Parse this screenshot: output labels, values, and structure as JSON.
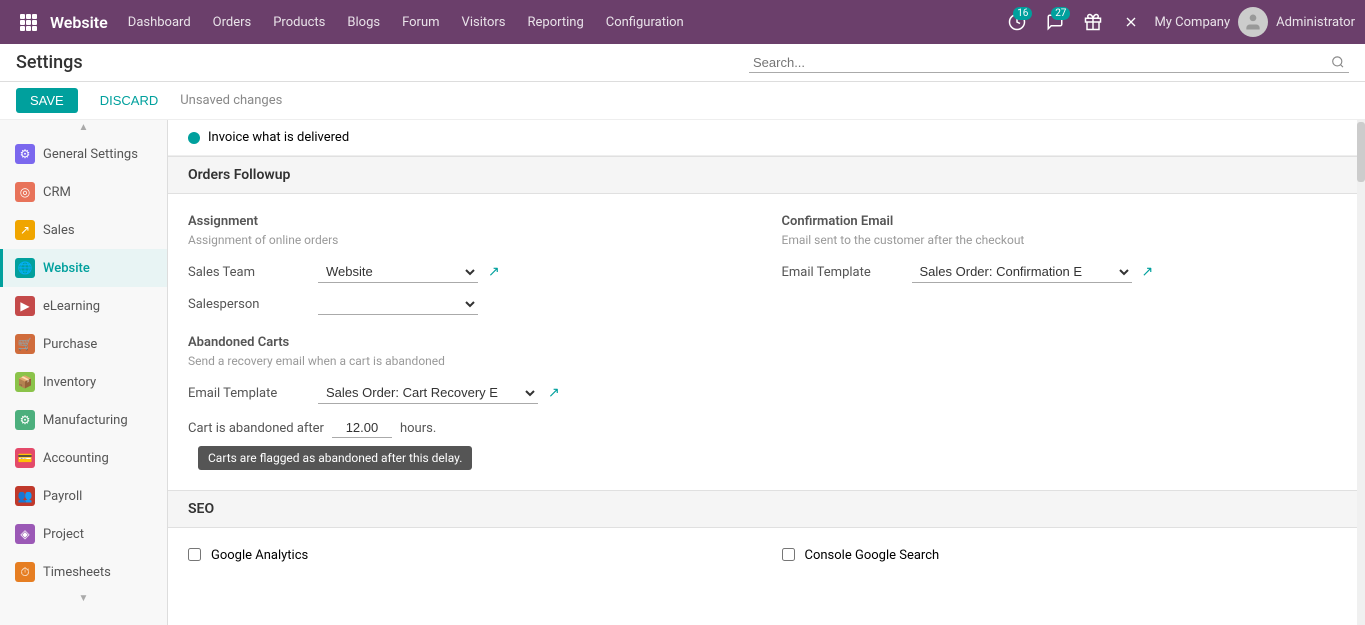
{
  "app": {
    "brand": "Website",
    "nav_links": [
      "Dashboard",
      "Orders",
      "Products",
      "Blogs",
      "Forum",
      "Visitors",
      "Reporting",
      "Configuration"
    ],
    "active_nav": "Website",
    "badge_clock": "16",
    "badge_chat": "27",
    "company": "My Company",
    "user": "Administrator"
  },
  "header": {
    "title": "Settings",
    "search_placeholder": "Search...",
    "save_label": "SAVE",
    "discard_label": "DISCARD",
    "unsaved_label": "Unsaved changes"
  },
  "sidebar": {
    "items": [
      {
        "id": "general-settings",
        "label": "General Settings",
        "icon": "⚙",
        "icon_class": "icon-general"
      },
      {
        "id": "crm",
        "label": "CRM",
        "icon": "◎",
        "icon_class": "icon-crm"
      },
      {
        "id": "sales",
        "label": "Sales",
        "icon": "📈",
        "icon_class": "icon-sales"
      },
      {
        "id": "website",
        "label": "Website",
        "icon": "🌐",
        "icon_class": "icon-website",
        "active": true
      },
      {
        "id": "elearning",
        "label": "eLearning",
        "icon": "▶",
        "icon_class": "icon-elearning"
      },
      {
        "id": "purchase",
        "label": "Purchase",
        "icon": "🛒",
        "icon_class": "icon-purchase"
      },
      {
        "id": "inventory",
        "label": "Inventory",
        "icon": "📦",
        "icon_class": "icon-inventory"
      },
      {
        "id": "manufacturing",
        "label": "Manufacturing",
        "icon": "⚙",
        "icon_class": "icon-manufacturing"
      },
      {
        "id": "accounting",
        "label": "Accounting",
        "icon": "💳",
        "icon_class": "icon-accounting"
      },
      {
        "id": "payroll",
        "label": "Payroll",
        "icon": "👥",
        "icon_class": "icon-payroll"
      },
      {
        "id": "project",
        "label": "Project",
        "icon": "◈",
        "icon_class": "icon-project"
      },
      {
        "id": "timesheets",
        "label": "Timesheets",
        "icon": "⏱",
        "icon_class": "icon-timesheets"
      }
    ]
  },
  "content": {
    "invoice_text": "Invoice what is delivered",
    "orders_followup_title": "Orders Followup",
    "assignment": {
      "title": "Assignment",
      "description": "Assignment of online orders",
      "sales_team_label": "Sales Team",
      "sales_team_value": "Website",
      "salesperson_label": "Salesperson",
      "salesperson_value": ""
    },
    "confirmation_email": {
      "title": "Confirmation Email",
      "description": "Email sent to the customer after the checkout",
      "email_template_label": "Email Template",
      "email_template_value": "Sales Order: Confirmation E"
    },
    "abandoned_carts": {
      "title": "Abandoned Carts",
      "description": "Send a recovery email when a cart is abandoned",
      "email_template_label": "Email Template",
      "email_template_value": "Sales Order: Cart Recovery E",
      "cart_abandoned_label": "Cart is abandoned after",
      "hours_value": "12.00",
      "hours_label": "hours.",
      "tooltip": "Carts are flagged as abandoned after this delay."
    },
    "seo": {
      "title": "SEO",
      "google_analytics_label": "Google Analytics",
      "console_google_search_label": "Console Google Search"
    }
  }
}
